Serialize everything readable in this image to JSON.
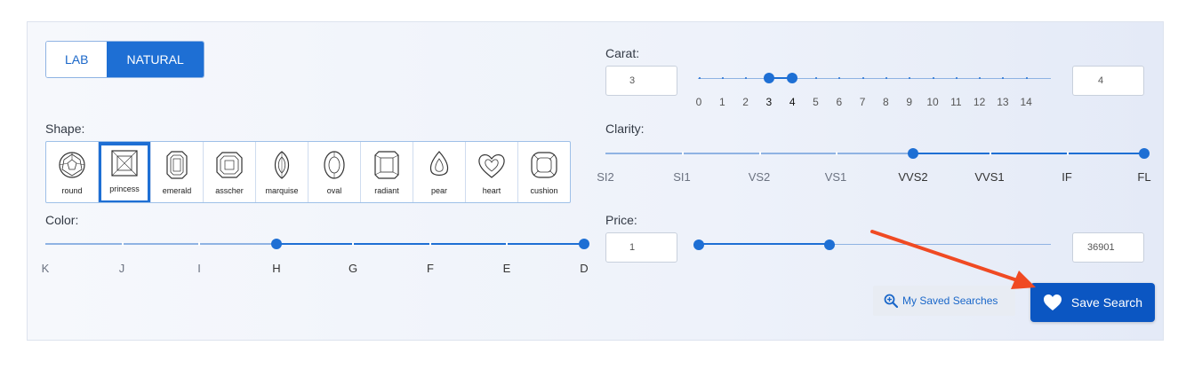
{
  "type_toggle": {
    "options": [
      "LAB",
      "NATURAL"
    ],
    "selected": "NATURAL"
  },
  "shape": {
    "label": "Shape:",
    "items": [
      {
        "name": "round",
        "icon": "round-diamond-icon"
      },
      {
        "name": "princess",
        "icon": "princess-diamond-icon"
      },
      {
        "name": "emerald",
        "icon": "emerald-diamond-icon"
      },
      {
        "name": "asscher",
        "icon": "asscher-diamond-icon"
      },
      {
        "name": "marquise",
        "icon": "marquise-diamond-icon"
      },
      {
        "name": "oval",
        "icon": "oval-diamond-icon"
      },
      {
        "name": "radiant",
        "icon": "radiant-diamond-icon"
      },
      {
        "name": "pear",
        "icon": "pear-diamond-icon"
      },
      {
        "name": "heart",
        "icon": "heart-diamond-icon"
      },
      {
        "name": "cushion",
        "icon": "cushion-diamond-icon"
      }
    ],
    "selected": "princess"
  },
  "color": {
    "label": "Color:",
    "grades": [
      "K",
      "J",
      "I",
      "H",
      "G",
      "F",
      "E",
      "D"
    ],
    "selected_from": "H",
    "selected_to": "D"
  },
  "carat": {
    "label": "Carat:",
    "min_value": "3",
    "max_value": "4",
    "scale": [
      "0",
      "1",
      "2",
      "3",
      "4",
      "5",
      "6",
      "7",
      "8",
      "9",
      "10",
      "11",
      "12",
      "13",
      "14"
    ]
  },
  "clarity": {
    "label": "Clarity:",
    "grades": [
      "SI2",
      "SI1",
      "VS2",
      "VS1",
      "VVS2",
      "VVS1",
      "IF",
      "FL"
    ],
    "selected_from": "VVS2",
    "selected_to": "FL"
  },
  "price": {
    "label": "Price:",
    "min_value": "1",
    "max_value": "36901",
    "upper_handle_fraction": 0.37
  },
  "actions": {
    "saved_searches": "My Saved Searches",
    "save_search": "Save Search"
  },
  "colors": {
    "accent": "#1e6fd4",
    "save_button": "#0b56c2",
    "arrow": "#f04a23"
  }
}
